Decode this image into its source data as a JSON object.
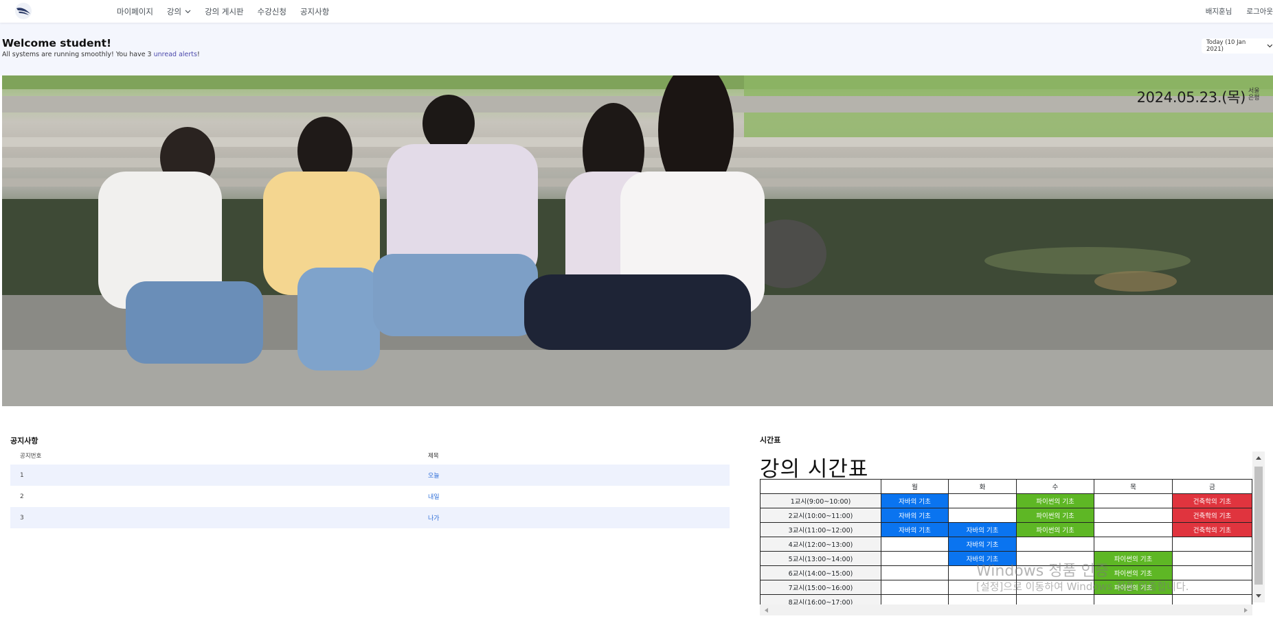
{
  "nav": {
    "links": [
      {
        "label": "마이페이지"
      },
      {
        "label": "강의"
      },
      {
        "label": "강의 게시판"
      },
      {
        "label": "수강신청"
      },
      {
        "label": "공지사항"
      }
    ],
    "user_name": "배지훈님",
    "logout": "로그아웃"
  },
  "header": {
    "title": "Welcome student!",
    "subtitle_prefix": "All systems are running smoothly! You have 3 ",
    "subtitle_link": "unread alerts",
    "subtitle_suffix": "!",
    "date_button": "Today (10 Jan 2021)"
  },
  "hero": {
    "date": "2024.05.23.(목)",
    "location": "서울 은평"
  },
  "notice": {
    "title": "공지사항",
    "col_number": "공지번호",
    "col_title": "제목",
    "rows": [
      {
        "no": "1",
        "title": "오늘"
      },
      {
        "no": "2",
        "title": "내일"
      },
      {
        "no": "3",
        "title": "나가"
      }
    ]
  },
  "timetable": {
    "label": "시간표",
    "heading": "강의 시간표",
    "days": [
      "월",
      "화",
      "수",
      "목",
      "금"
    ],
    "rows": [
      {
        "period": "1교시(9:00~10:00)",
        "cells": [
          "자바의 기초",
          "",
          "파이썬의 기초",
          "",
          "건축학의 기초"
        ]
      },
      {
        "period": "2교시(10:00~11:00)",
        "cells": [
          "자바의 기초",
          "",
          "파이썬의 기초",
          "",
          "건축학의 기초"
        ]
      },
      {
        "period": "3교시(11:00~12:00)",
        "cells": [
          "자바의 기초",
          "자바의 기초",
          "파이썬의 기초",
          "",
          "건축학의 기초"
        ]
      },
      {
        "period": "4교시(12:00~13:00)",
        "cells": [
          "",
          "자바의 기초",
          "",
          "",
          ""
        ]
      },
      {
        "period": "5교시(13:00~14:00)",
        "cells": [
          "",
          "자바의 기초",
          "",
          "파이썬의 기초",
          ""
        ]
      },
      {
        "period": "6교시(14:00~15:00)",
        "cells": [
          "",
          "",
          "",
          "파이썬의 기초",
          ""
        ]
      },
      {
        "period": "7교시(15:00~16:00)",
        "cells": [
          "",
          "",
          "",
          "파이썬의 기초",
          ""
        ]
      },
      {
        "period": "8교시(16:00~17:00)",
        "cells": [
          "",
          "",
          "",
          "",
          ""
        ]
      }
    ],
    "colors": {
      "java": "#0a74f0",
      "python": "#5eb725",
      "arch": "#e0343e"
    }
  },
  "watermark": {
    "line1": "Windows 정품 인증",
    "line2": "[설정]으로 이동하여 Windows 정품 인증합니다."
  },
  "icons": [
    "logo-icon",
    "chevron-down-icon",
    "scroll-up-arrow-icon",
    "scroll-down-arrow-icon",
    "scroll-left-arrow-icon",
    "scroll-right-arrow-icon"
  ]
}
